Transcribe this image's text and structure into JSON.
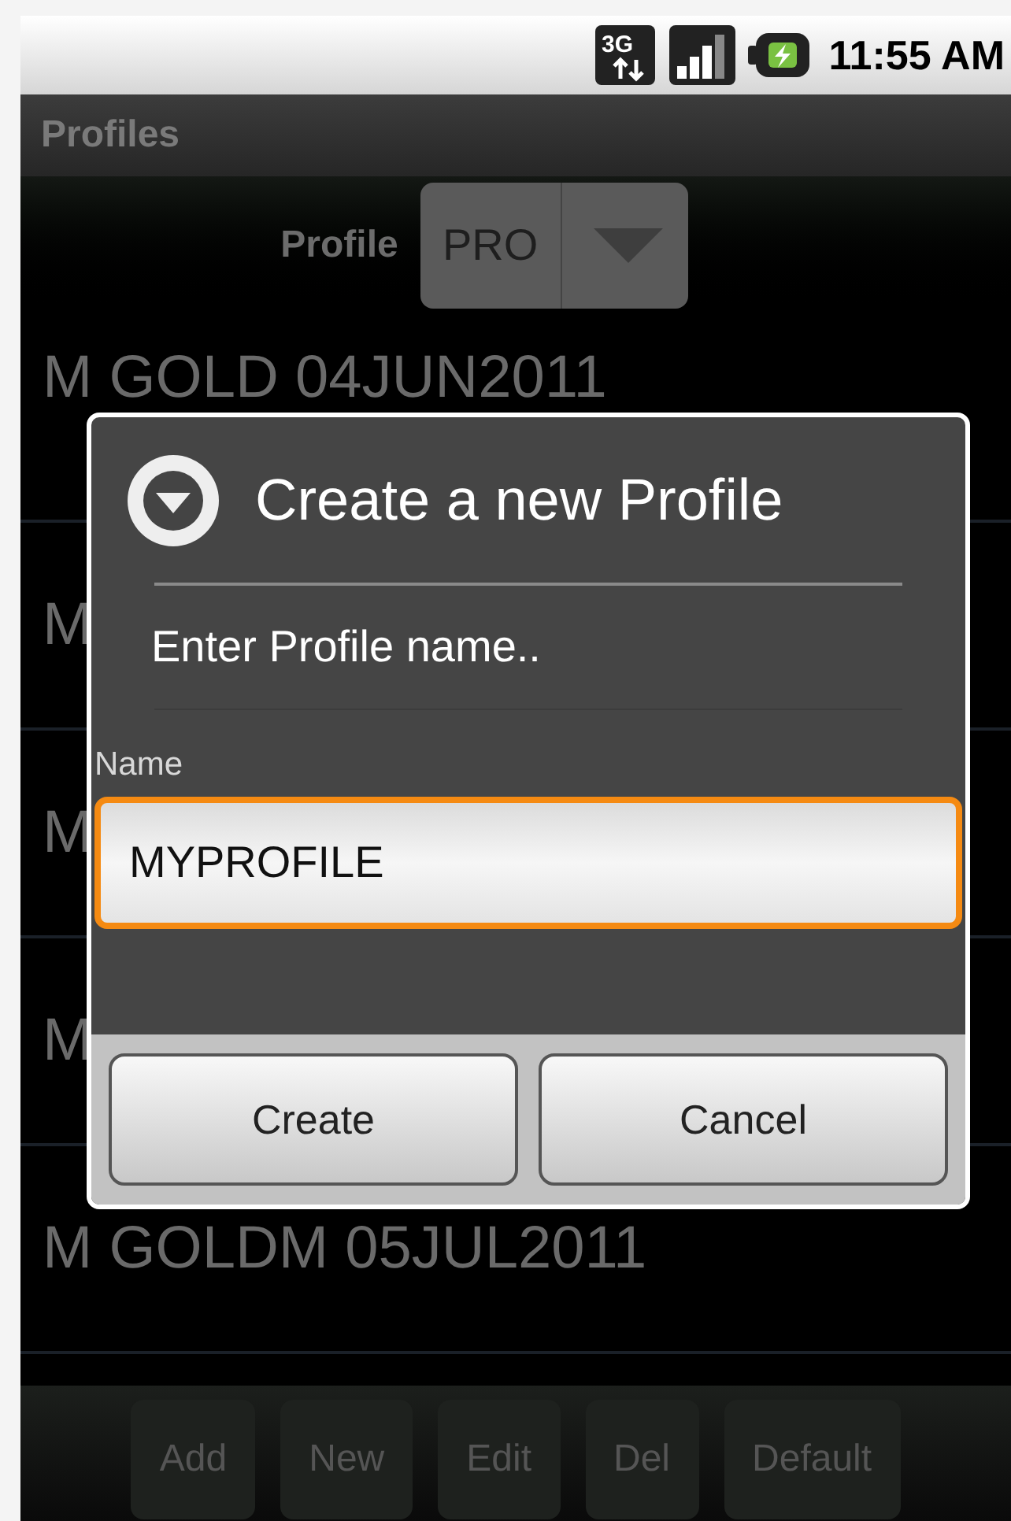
{
  "status_bar": {
    "network": "3G",
    "time": "11:55 AM"
  },
  "title": "Profiles",
  "profile_picker": {
    "label": "Profile",
    "value": "PRO"
  },
  "list": [
    {
      "text": "M GOLD 04JUN2011"
    },
    {
      "text": "M"
    },
    {
      "text": "M"
    },
    {
      "text": "M"
    },
    {
      "text": "M GOLDM 05JUL2011"
    }
  ],
  "dialog": {
    "title": "Create a new Profile",
    "message": "Enter Profile name..",
    "field": {
      "label": "Name",
      "value": "MYPROFILE",
      "focused": true
    },
    "buttons": [
      "Create",
      "Cancel"
    ]
  },
  "toolbar": [
    "Add",
    "New",
    "Edit",
    "Del",
    "Default"
  ]
}
